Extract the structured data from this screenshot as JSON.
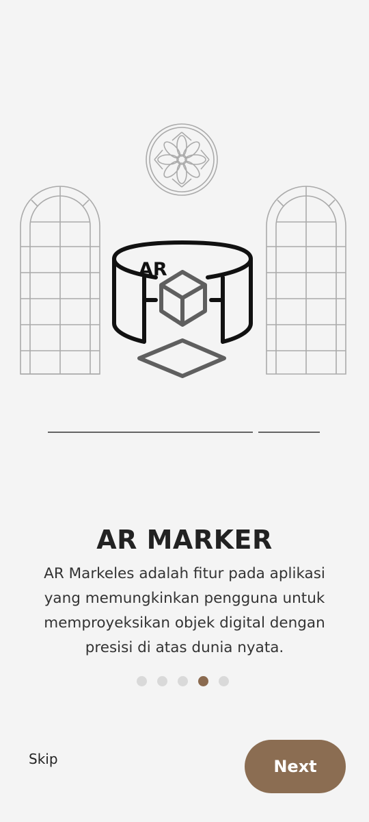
{
  "onboarding": {
    "title": "AR MARKER",
    "description": "AR Markeles adalah fitur pada aplikasi yang memungkinkan pengguna untuk memproyeksikan objek digital dengan presisi di atas dunia nyata.",
    "ar_label": "AR",
    "total_pages": 5,
    "current_page": 4
  },
  "actions": {
    "skip_label": "Skip",
    "next_label": "Next"
  },
  "colors": {
    "background": "#f4f4f4",
    "accent": "#8b6d52",
    "dot_inactive": "#d9d9d9",
    "illustration_line": "#aaaaaa",
    "icon_dark": "#111111",
    "icon_gray": "#5f5f5f"
  }
}
